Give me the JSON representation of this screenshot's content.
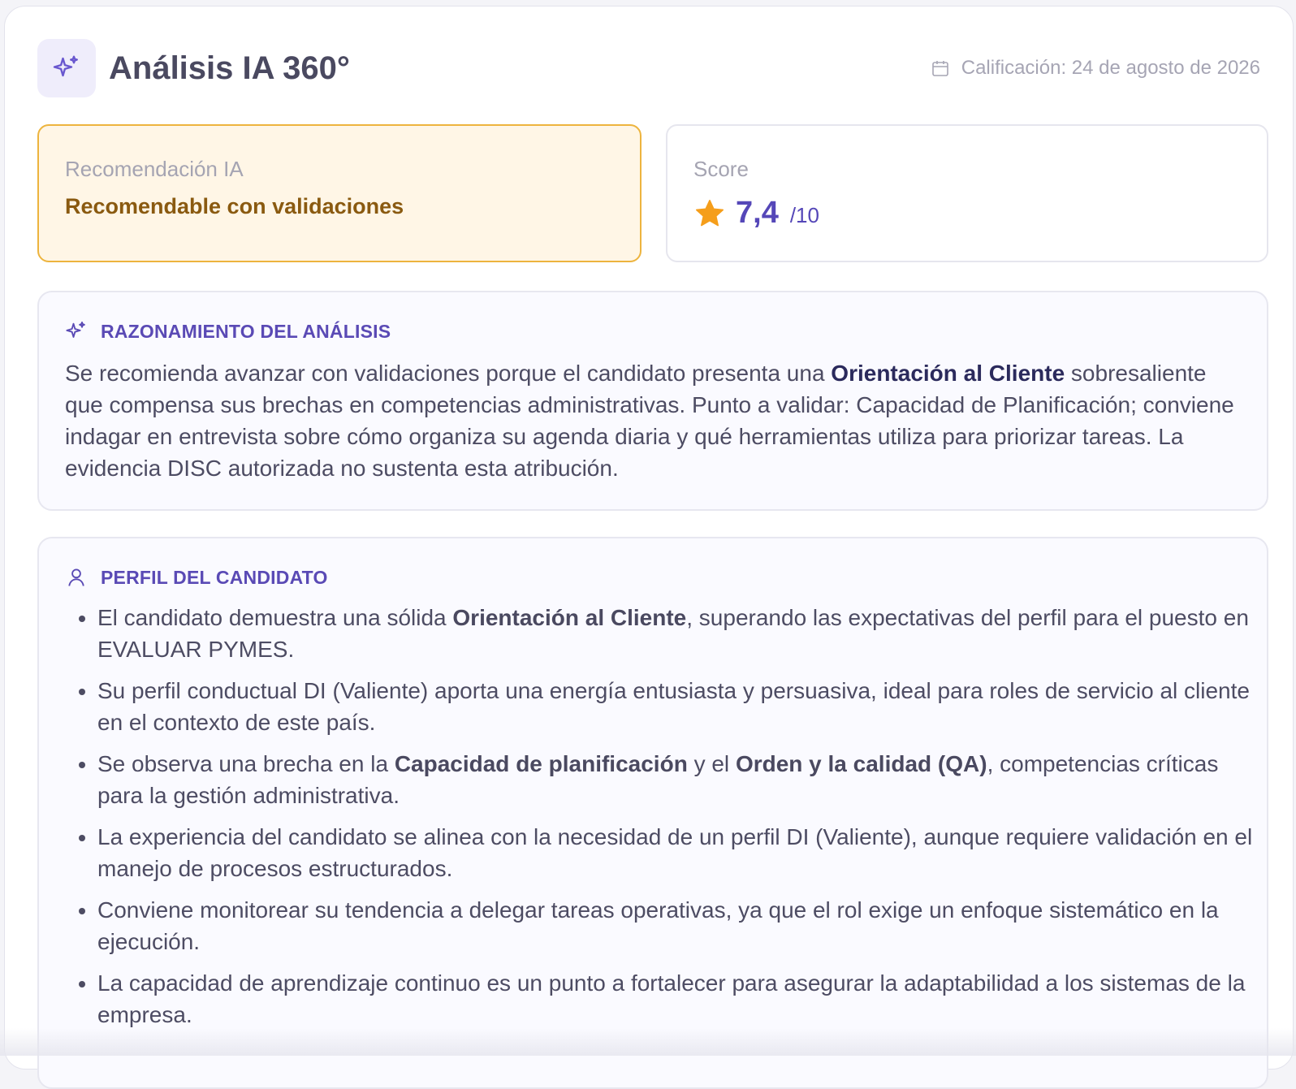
{
  "header": {
    "title": "Análisis IA 360°",
    "date_label": "Calificación: 24 de agosto de 2026",
    "logo_icon": "sparkles-icon",
    "date_icon": "calendar-icon"
  },
  "recommendation": {
    "label": "Recomendación IA",
    "value": "Recomendable con validaciones",
    "accent_color": "#edb43e"
  },
  "score": {
    "label": "Score",
    "value": "7,4",
    "max": "/10",
    "icon": "star-icon",
    "star_color": "#f59e1b"
  },
  "reasoning": {
    "heading": "RAZONAMIENTO DEL ANÁLISIS",
    "icon": "sparkles-icon",
    "text_before": "Se recomienda avanzar con validaciones porque el candidato presenta una ",
    "text_bold": "Orientación al Cliente",
    "text_after": " sobresaliente que compensa sus brechas en competencias administrativas. Punto a validar: Capacidad de Planificación; conviene indagar en entrevista sobre cómo organiza su agenda diaria y qué herramientas utiliza para priorizar tareas. La evidencia DISC autorizada no sustenta esta atribución."
  },
  "profile": {
    "heading": "PERFIL DEL CANDIDATO",
    "icon": "user-icon",
    "bullets": [
      {
        "a": "El candidato demuestra una sólida ",
        "b": "Orientación al Cliente",
        "c": ", superando las expectativas del perfil para el puesto en EVALUAR PYMES."
      },
      {
        "a": "Su perfil conductual DI (Valiente) aporta una energía entusiasta y persuasiva, ideal para roles de servicio al cliente en el contexto de este país."
      },
      {
        "a": "Se observa una brecha en la ",
        "b": "Capacidad de planificación",
        "c": " y el ",
        "d": "Orden y la calidad (QA)",
        "e": ", competencias críticas para la gestión administrativa."
      },
      {
        "a": "La experiencia del candidato se alinea con la necesidad de un perfil DI (Valiente), aunque requiere validación en el manejo de procesos estructurados."
      },
      {
        "a": "Conviene monitorear su tendencia a delegar tareas operativas, ya que el rol exige un enfoque sistemático en la ejecución."
      },
      {
        "a": "La capacidad de aprendizaje continuo es un punto a fortalecer para asegurar la adaptabilidad a los sistemas de la empresa."
      }
    ]
  }
}
